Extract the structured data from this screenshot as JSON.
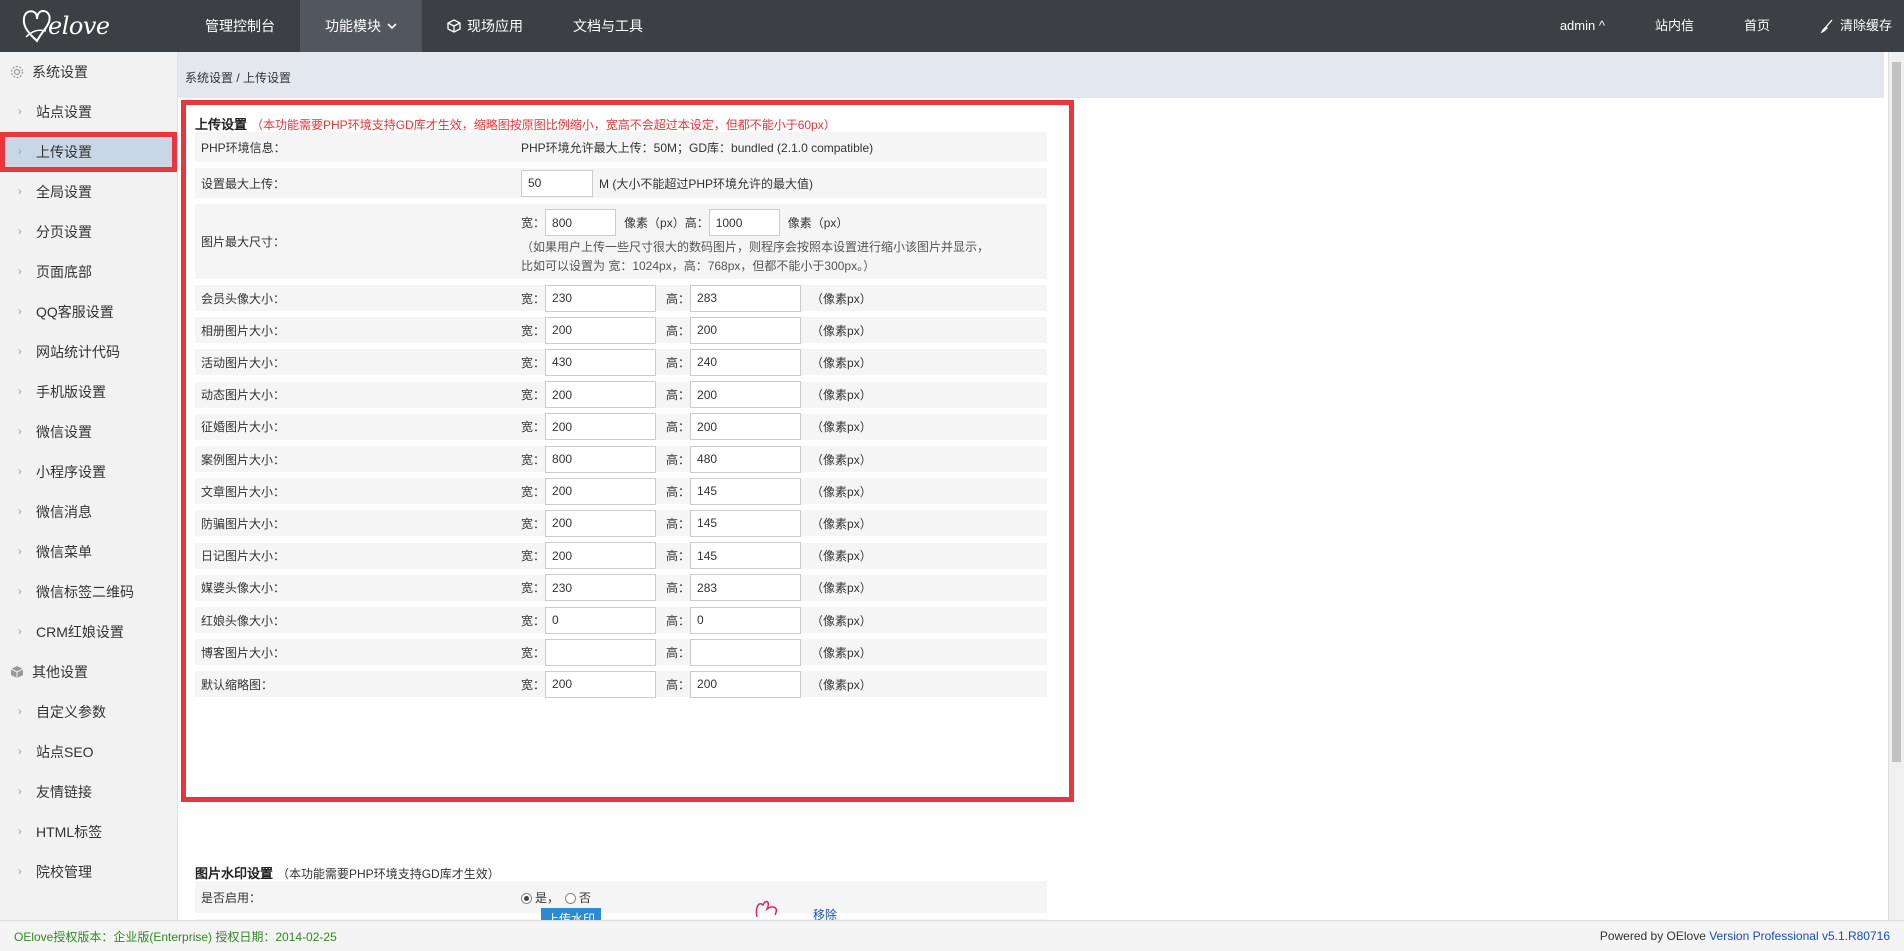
{
  "brand": {
    "logo_text": "elove"
  },
  "topnav": {
    "items": [
      {
        "label": "管理控制台"
      },
      {
        "label": "功能模块"
      },
      {
        "label": "现场应用"
      },
      {
        "label": "文档与工具"
      }
    ],
    "right": [
      {
        "label": "admin ^"
      },
      {
        "label": "站内信"
      },
      {
        "label": "首页"
      },
      {
        "label": "清除缓存"
      }
    ]
  },
  "sidebar": {
    "group1": "系统设置",
    "items1": [
      "站点设置",
      "上传设置",
      "全局设置",
      "分页设置",
      "页面底部",
      "QQ客服设置",
      "网站统计代码",
      "手机版设置",
      "微信设置",
      "小程序设置",
      "微信消息",
      "微信菜单",
      "微信标签二维码",
      "CRM红娘设置"
    ],
    "group2": "其他设置",
    "items2": [
      "自定义参数",
      "站点SEO",
      "友情链接",
      "HTML标签",
      "院校管理"
    ]
  },
  "breadcrumb": "系统设置 / 上传设置",
  "upload": {
    "title": "上传设置",
    "note": "（本功能需要PHP环境支持GD库才生效，缩略图按原图比例缩小，宽高不会超过本设定，但都不能小于60px）",
    "php_label": "PHP环境信息：",
    "php_value": "PHP环境允许最大上传：50M；GD库：bundled (2.1.0 compatible)",
    "max_label": "设置最大上传：",
    "max_value": "50",
    "max_unit": "M (大小不能超过PHP环境允许的最大值)",
    "img_label": "图片最大尺寸：",
    "img_w_label": "宽：",
    "img_w": "800",
    "img_unit1": "像素（px）高：",
    "img_h": "1000",
    "img_unit2": "像素（px）",
    "img_hint1": "（如果用户上传一些尺寸很大的数码图片，则程序会按照本设置进行缩小该图片并显示，",
    "img_hint2": "比如可以设置为 宽：1024px，高：768px，但都不能小于300px。）",
    "w_label": "宽：",
    "h_label": "高：",
    "unit": "（像素px）",
    "rows": [
      {
        "label": "会员头像大小：",
        "w": "230",
        "h": "283"
      },
      {
        "label": "相册图片大小：",
        "w": "200",
        "h": "200"
      },
      {
        "label": "活动图片大小：",
        "w": "430",
        "h": "240"
      },
      {
        "label": "动态图片大小：",
        "w": "200",
        "h": "200"
      },
      {
        "label": "征婚图片大小：",
        "w": "200",
        "h": "200"
      },
      {
        "label": "案例图片大小：",
        "w": "800",
        "h": "480"
      },
      {
        "label": "文章图片大小：",
        "w": "200",
        "h": "145"
      },
      {
        "label": "防骗图片大小：",
        "w": "200",
        "h": "145"
      },
      {
        "label": "日记图片大小：",
        "w": "200",
        "h": "145"
      },
      {
        "label": "媒婆头像大小：",
        "w": "230",
        "h": "283"
      },
      {
        "label": "红娘头像大小：",
        "w": "0",
        "h": "0"
      },
      {
        "label": "博客图片大小：",
        "w": "",
        "h": ""
      },
      {
        "label": "默认缩略图：",
        "w": "200",
        "h": "200"
      }
    ]
  },
  "watermark": {
    "title": "图片水印设置",
    "note": "（本功能需要PHP环境支持GD库才生效）",
    "enable_label": "是否启用：",
    "yes": "是，",
    "no": "否",
    "upload_btn": "上传水印",
    "remove": "移除"
  },
  "footer": {
    "left": "OElove授权版本：企业版(Enterprise) 授权日期：2014-02-25",
    "right_prefix": "Powered by OElove ",
    "right_version": "Version Professional v5.1.R80716"
  },
  "colors": {
    "topbar": "#3c3f44",
    "highlight": "#e8363c",
    "green": "#2e8b1e",
    "link": "#1b4db5"
  }
}
